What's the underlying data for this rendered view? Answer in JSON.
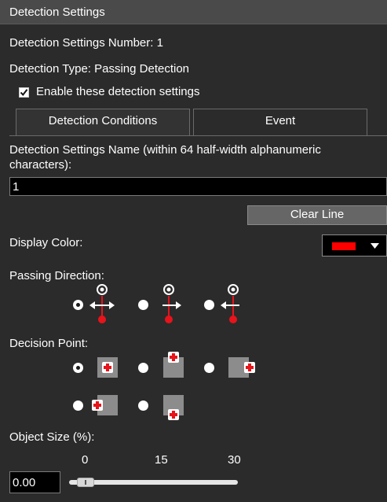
{
  "panel": {
    "title": "Detection Settings"
  },
  "settings_number": "Detection Settings Number: 1",
  "detection_type": "Detection Type: Passing Detection",
  "enable": {
    "label": "Enable these detection settings",
    "checked": true
  },
  "tabs": [
    {
      "label": "Detection Conditions",
      "active": true
    },
    {
      "label": "Event",
      "active": false
    }
  ],
  "name_field": {
    "label_line1": "Detection Settings Name (within 64 half-width alphanumeric",
    "label_line2": "characters):",
    "value": "1"
  },
  "clear_line_label": "Clear Line",
  "display_color": {
    "label": "Display Color:",
    "value": "#ff0000"
  },
  "passing_direction": {
    "label": "Passing Direction:",
    "options": [
      "both",
      "right",
      "left"
    ],
    "selected": "both",
    "icon_names": [
      "arrow-both-icon",
      "arrow-right-icon",
      "arrow-left-icon"
    ]
  },
  "decision_point": {
    "label": "Decision Point:",
    "options": [
      "center",
      "top",
      "right",
      "left",
      "bottom"
    ],
    "selected": "center"
  },
  "object_size": {
    "label": "Object Size (%):",
    "ticks": [
      "0",
      "15",
      "30"
    ],
    "value": "0.00",
    "slider_fraction": 0
  },
  "colors": {
    "accent_red": "#e8131b",
    "background": "#2b2b2b",
    "titlebar": "#4a4a4a"
  }
}
